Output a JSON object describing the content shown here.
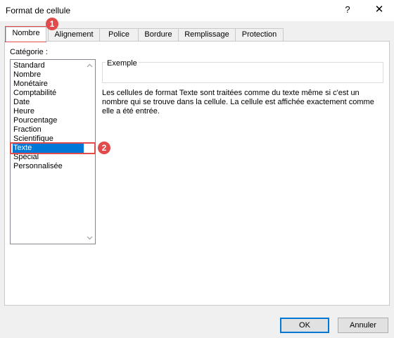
{
  "window": {
    "title": "Format de cellule",
    "help_label": "?",
    "close_label": "✕"
  },
  "tabs": [
    {
      "label": "Nombre",
      "active": true
    },
    {
      "label": "Alignement"
    },
    {
      "label": "Police"
    },
    {
      "label": "Bordure"
    },
    {
      "label": "Remplissage"
    },
    {
      "label": "Protection"
    }
  ],
  "category": {
    "label": "Catégorie :",
    "items": [
      "Standard",
      "Nombre",
      "Monétaire",
      "Comptabilité",
      "Date",
      "Heure",
      "Pourcentage",
      "Fraction",
      "Scientifique",
      "Texte",
      "Spécial",
      "Personnalisée"
    ],
    "selected": "Texte"
  },
  "preview": {
    "label": "Exemple"
  },
  "description": "Les cellules de format Texte sont traitées comme du texte même si c'est un nombre qui se trouve dans la cellule. La cellule est affichée exactement comme elle a été entrée.",
  "buttons": {
    "ok": "OK",
    "cancel": "Annuler"
  },
  "annotations": {
    "badge1": "1",
    "badge2": "2",
    "color": "#e14b4b"
  },
  "colors": {
    "selection": "#0078d7",
    "ok_border": "#0078d7"
  },
  "icons": {
    "scroll_up": "chevron-up-icon",
    "scroll_down": "chevron-down-icon"
  }
}
